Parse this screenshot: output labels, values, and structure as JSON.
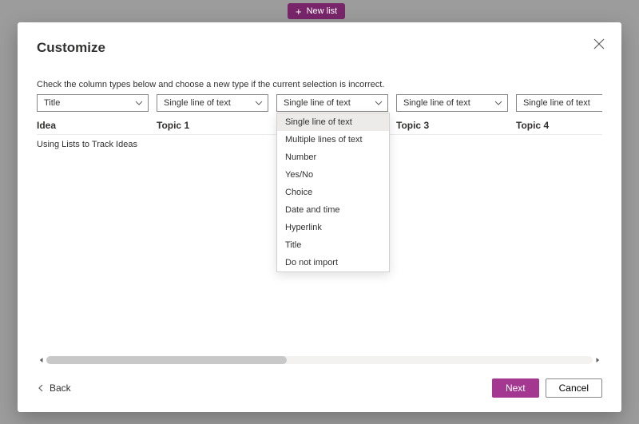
{
  "top_button": {
    "label": "New list"
  },
  "dialog": {
    "title": "Customize",
    "instruction": "Check the column types below and choose a new type if the current selection is incorrect.",
    "columns": [
      {
        "selected": "Title",
        "header": "Idea",
        "open": false
      },
      {
        "selected": "Single line of text",
        "header": "Topic 1",
        "open": false
      },
      {
        "selected": "Single line of text",
        "header": "",
        "open": true
      },
      {
        "selected": "Single line of text",
        "header": "Topic 3",
        "open": false
      },
      {
        "selected": "Single line of text",
        "header": "Topic 4",
        "open": false
      }
    ],
    "type_options": [
      "Single line of text",
      "Multiple lines of text",
      "Number",
      "Yes/No",
      "Choice",
      "Date and time",
      "Hyperlink",
      "Title",
      "Do not import"
    ],
    "rows": [
      {
        "cells": [
          "Using Lists to Track Ideas",
          "",
          "",
          "",
          ""
        ]
      }
    ],
    "footer": {
      "back": "Back",
      "next": "Next",
      "cancel": "Cancel"
    }
  }
}
